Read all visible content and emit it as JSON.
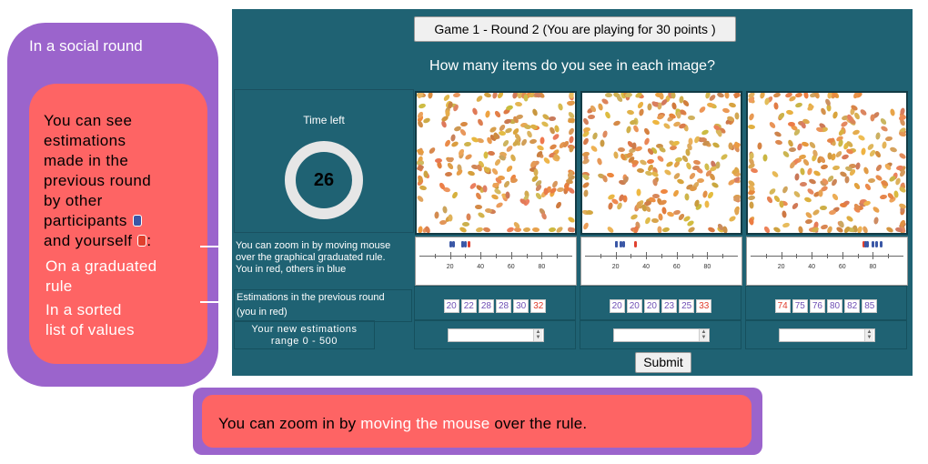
{
  "annotation_left": {
    "title": "In a social round",
    "lines": [
      "You can see",
      "estimations",
      "made in the",
      "previous round",
      "by other",
      "participants",
      "and yourself",
      ":"
    ],
    "graduated_pre": "On a ",
    "graduated_hl": "graduated",
    "graduated_post": "rule",
    "sorted_line1": "In a sorted",
    "sorted_line2": "list of values"
  },
  "annotation_bottom": {
    "pre": "You can zoom in by ",
    "hl": "moving the mouse",
    "post": " over the rule."
  },
  "header": {
    "round_label": "Game 1 - Round 2 (You are playing for 30 points )",
    "question": "How many items do you see in each image?"
  },
  "timer": {
    "label": "Time left",
    "value": "26"
  },
  "ruler_help": {
    "line1": "You can zoom in by moving mouse",
    "line2": "over the graphical graduated rule.",
    "line3": "You in red, others in blue"
  },
  "estimations": {
    "label_line1": "Estimations in the previous round",
    "label_line2": "(you in red)"
  },
  "new_estimation": {
    "line1": "Your new estimations",
    "line2": "range 0 - 500"
  },
  "submit_label": "Submit",
  "rulers": [
    {
      "ticks": [
        "20",
        "40",
        "60",
        "80"
      ]
    },
    {
      "ticks": [
        "20",
        "40",
        "60",
        "80"
      ]
    },
    {
      "ticks": [
        "20",
        "40",
        "60",
        "80"
      ]
    }
  ],
  "previous_estimates": [
    {
      "values": [
        "20",
        "22",
        "28",
        "28",
        "30",
        "32"
      ],
      "own_index": 5
    },
    {
      "values": [
        "20",
        "20",
        "20",
        "23",
        "25",
        "33"
      ],
      "own_index": 5
    },
    {
      "values": [
        "74",
        "75",
        "76",
        "80",
        "82",
        "85"
      ],
      "own_index": 0
    }
  ],
  "colors": {
    "panel_bg": "#1f6273",
    "annotation_purple": "#9b64cc",
    "annotation_salmon": "#fe6464",
    "other_marker": "#3a57a6",
    "own_marker": "#e0402e",
    "item_color": "#d98e4a"
  }
}
